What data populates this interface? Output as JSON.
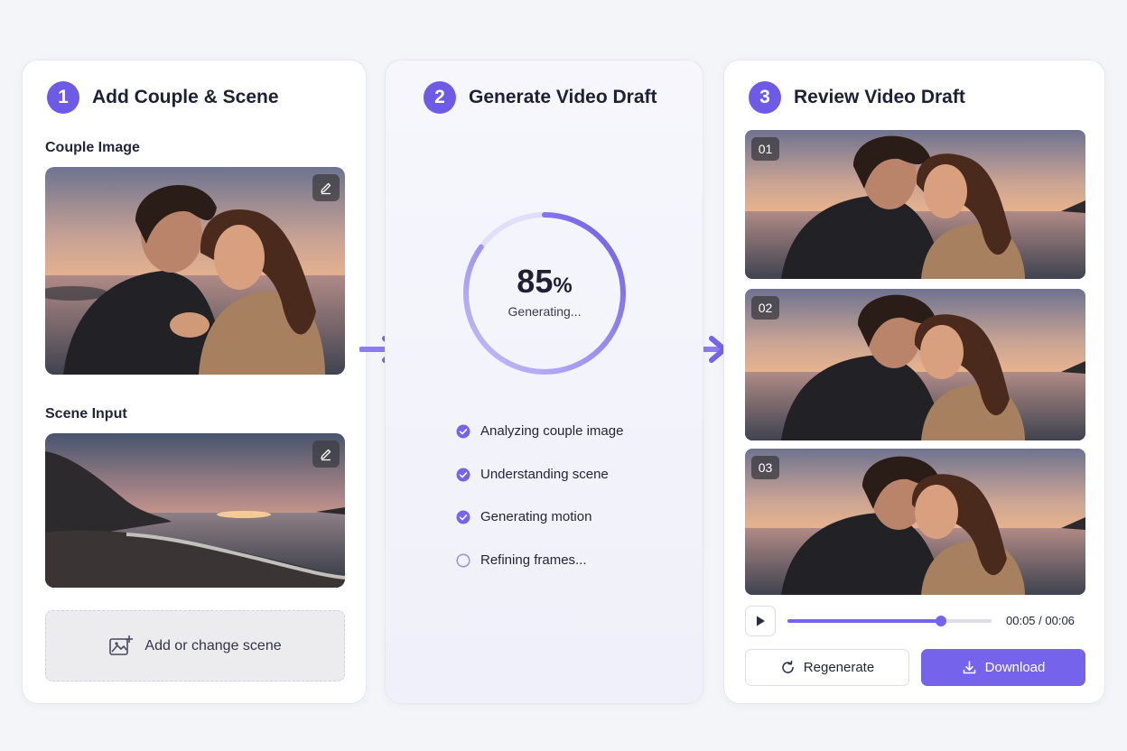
{
  "steps": [
    {
      "number": "1",
      "title": "Add Couple & Scene"
    },
    {
      "number": "2",
      "title": "Generate Video Draft"
    },
    {
      "number": "3",
      "title": "Review Video Draft"
    }
  ],
  "step1": {
    "couple_image_label": "Couple Image",
    "scene_input_label": "Scene Input",
    "dropzone_label": "Add or change scene"
  },
  "step2": {
    "progress": 85,
    "progress_value": "85",
    "progress_unit": "%",
    "status": "Generating...",
    "tasks": [
      {
        "label": "Analyzing couple image",
        "done": true
      },
      {
        "label": "Understanding scene",
        "done": true
      },
      {
        "label": "Generating motion",
        "done": true
      },
      {
        "label": "Refining frames...",
        "done": false
      }
    ]
  },
  "step3": {
    "frames": [
      {
        "label": "01"
      },
      {
        "label": "02"
      },
      {
        "label": "03"
      }
    ],
    "playback": {
      "time": "00:05 / 00:06",
      "progress": 0.75
    },
    "regenerate_label": "Regenerate",
    "download_label": "Download"
  },
  "colors": {
    "accent": "#6d5be8",
    "accent_light": "#d6d0f8",
    "background": "#f4f5f9"
  },
  "icons": [
    "edit-icon",
    "add-image-icon",
    "arrow-right-icon",
    "check-circle-icon",
    "empty-circle-icon",
    "play-icon",
    "refresh-icon",
    "download-icon"
  ]
}
